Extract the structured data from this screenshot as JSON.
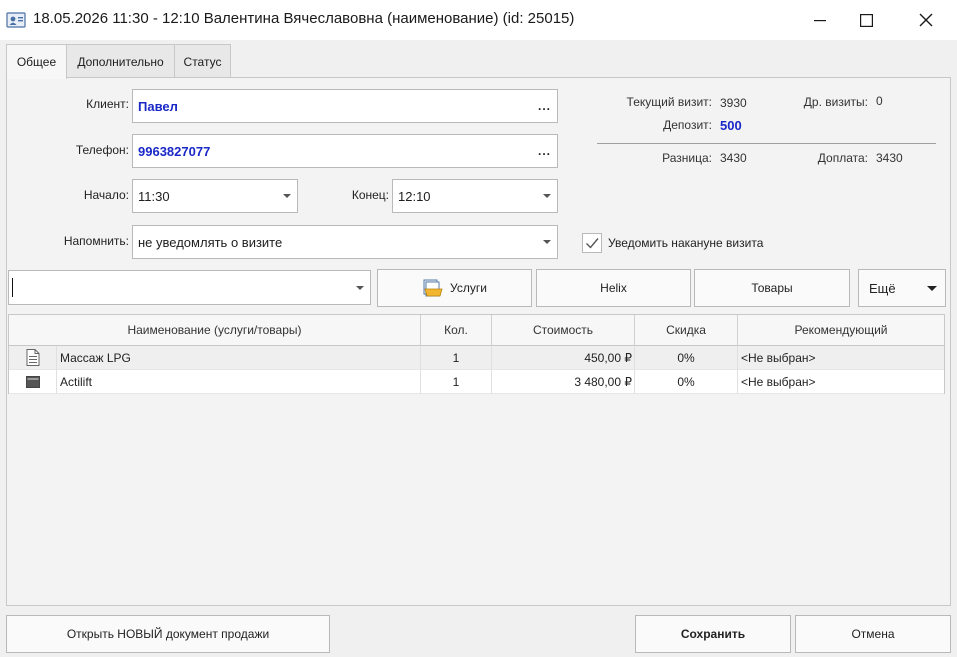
{
  "window": {
    "title": "18.05.2026 11:30 - 12:10 Валентина Вячеславовна (наименование) (id: 25015)"
  },
  "tabs": [
    {
      "label": "Общее",
      "active": true
    },
    {
      "label": "Дополнительно",
      "active": false
    },
    {
      "label": "Статус",
      "active": false
    }
  ],
  "form": {
    "client_label": "Клиент:",
    "client_value": "Павел",
    "phone_label": "Телефон:",
    "phone_value": "9963827077",
    "start_label": "Начало:",
    "start_value": "11:30",
    "end_label": "Конец:",
    "end_value": "12:10",
    "remind_label": "Напомнить:",
    "remind_value": "не уведомлять о визите",
    "notify_checkbox_label": "Уведомить накануне визита",
    "notify_checked": true,
    "ellipsis": "..."
  },
  "info": {
    "current_visit_label": "Текущий визит:",
    "current_visit_value": "3930",
    "other_visits_label": "Др. визиты:",
    "other_visits_value": "0",
    "deposit_label": "Депозит:",
    "deposit_value": "500",
    "difference_label": "Разница:",
    "difference_value": "3430",
    "surcharge_label": "Доплата:",
    "surcharge_value": "3430"
  },
  "toolbar": {
    "search_value": "",
    "services_label": "Услуги",
    "helix_label": "Helix",
    "goods_label": "Товары",
    "more_label": "Ещё"
  },
  "table": {
    "columns": [
      "Наименование (услуги/товары)",
      "Кол.",
      "Стоимость",
      "Скидка",
      "Рекомендующий"
    ],
    "rows": [
      {
        "icon": "document-icon",
        "name": "Массаж LPG",
        "qty": "1",
        "cost": "450,00 ₽",
        "discount": "0%",
        "referrer": "<Не выбран>"
      },
      {
        "icon": "wallet-icon",
        "name": "Actilift",
        "qty": "1",
        "cost": "3 480,00 ₽",
        "discount": "0%",
        "referrer": "<Не выбран>"
      }
    ]
  },
  "footer": {
    "new_sale_label": "Открыть НОВЫЙ документ продажи",
    "save_label": "Сохранить",
    "cancel_label": "Отмена"
  },
  "colors": {
    "accent_blue": "#1a28c8",
    "background": "#f0f0f0"
  }
}
